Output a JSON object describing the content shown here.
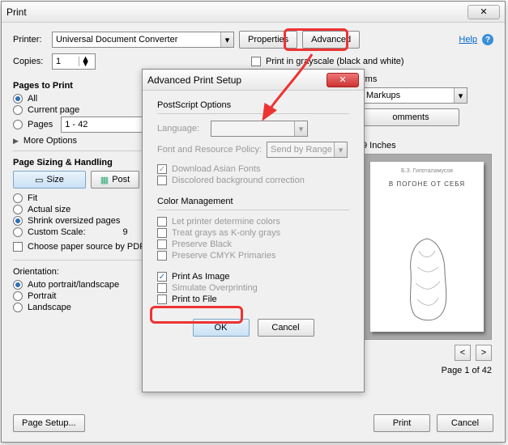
{
  "main": {
    "title": "Print",
    "printer_label": "Printer:",
    "printer_value": "Universal Document Converter",
    "properties_btn": "Properties",
    "advanced_btn": "Advanced",
    "help_link": "Help",
    "copies_label": "Copies:",
    "copies_value": "1",
    "grayscale": "Print in grayscale (black and white)",
    "pages_to_print": "Pages to Print",
    "all": "All",
    "current": "Current page",
    "pages_label": "Pages",
    "pages_range": "1 - 42",
    "more_options": "More Options",
    "sizing": "Page Sizing & Handling",
    "size_btn": "Size",
    "poster_btn": "Post",
    "fit": "Fit",
    "actual": "Actual size",
    "shrink": "Shrink oversized pages",
    "custom": "Custom Scale:",
    "custom_val": "9",
    "choose_paper": "Choose paper source by PDF p",
    "orientation": "Orientation:",
    "auto_orient": "Auto portrait/landscape",
    "portrait": "Portrait",
    "landscape": "Landscape",
    "pagesetup": "Page Setup...",
    "forms_partial": "rms",
    "markups": "Markups",
    "comments_btn": "omments",
    "dims": "9 Inches",
    "book_author": "Б.З. Гипоталамусов",
    "book_title": "В ПОГОНЕ ОТ СЕБЯ",
    "pageof": "Page 1 of 42",
    "print_btn": "Print",
    "cancel_btn": "Cancel"
  },
  "adv": {
    "title": "Advanced Print Setup",
    "ps_options": "PostScript Options",
    "language": "Language:",
    "policy": "Font and Resource Policy:",
    "policy_val": "Send by Range",
    "asian": "Download Asian Fonts",
    "discolor": "Discolored background correction",
    "color_mgmt": "Color Management",
    "let_printer": "Let printer determine colors",
    "treat_gray": "Treat grays as K-only grays",
    "preserve_black": "Preserve Black",
    "preserve_cmyk": "Preserve CMYK Primaries",
    "print_image": "Print As Image",
    "sim_over": "Simulate Overprinting",
    "print_file": "Print to File",
    "ok": "OK",
    "cancel": "Cancel"
  }
}
